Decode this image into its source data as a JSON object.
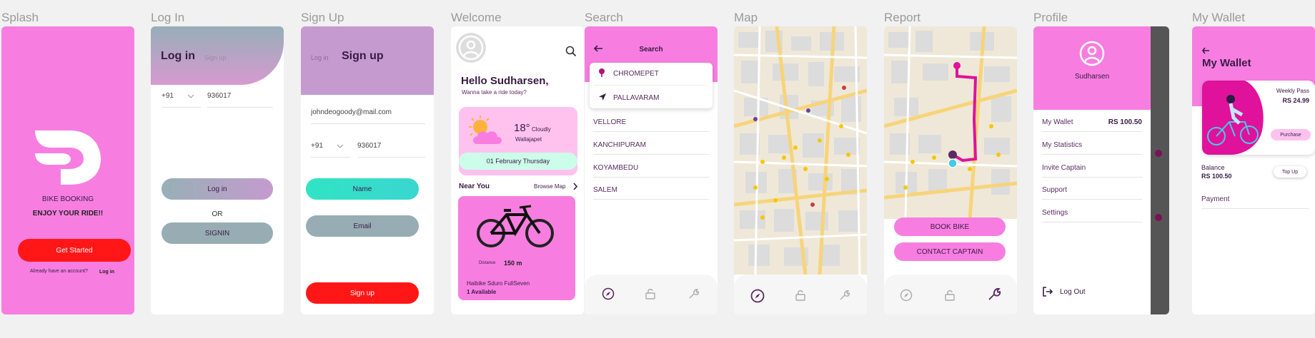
{
  "frames": {
    "splash": "Splash",
    "login": "Log In",
    "signup": "Sign Up",
    "welcome": "Welcome",
    "search": "Search",
    "map": "Map",
    "report": "Report",
    "profile": "Profile",
    "wallet": "My Wallet"
  },
  "splash": {
    "title": "BIKE BOOKING",
    "tagline": "ENJOY YOUR RIDE!!",
    "cta": "Get Started",
    "have_account": "Already have an account?",
    "login_link": "Log in"
  },
  "login": {
    "tab_active": "Log in",
    "tab_inactive": "Sign up",
    "country_code": "+91",
    "phone": "936017",
    "login_button": "Log in",
    "or": "OR",
    "signin_button": "SIGNIN"
  },
  "signup": {
    "tab_inactive": "Log in",
    "tab_active": "Sign up",
    "email": "johndeogoody@mail.com",
    "country_code": "+91",
    "phone": "936017",
    "name_button": "Name",
    "email_button": "Email",
    "signup_button": "Sign up"
  },
  "welcome": {
    "greeting": "Hello Sudharsen,",
    "sub": "Wanna take a ride today?",
    "temperature": "18°",
    "condition": "Cloudly",
    "location": "Wallajapet",
    "date": "01 February Thursday",
    "near_you": "Near You",
    "browse_map": "Browse Map",
    "distance_label": "Distance",
    "distance": "150 m",
    "bike_name": "Haibike Sduro FullSeven",
    "availability": "1 Available"
  },
  "search": {
    "title": "Search",
    "suggestions": [
      "CHROMEPET",
      "PALLAVARAM"
    ],
    "places": [
      "VELLORE",
      "KANCHIPURAM",
      "KOYAMBEDU",
      "SALEM"
    ]
  },
  "report": {
    "book_button": "BOOK BIKE",
    "contact_button": "CONTACT CAPTAIN"
  },
  "profile": {
    "name": "Sudharsen",
    "wallet_label": "My Wallet",
    "wallet_amount": "RS 100.50",
    "menu": [
      "My Statistics",
      "Invite Captain",
      "Support",
      "Settings"
    ],
    "logout": "Log Out"
  },
  "wallet": {
    "title": "My Wallet",
    "pass_name": "Weekly Pass",
    "pass_price": "RS 24.99",
    "purchase": "Purchase",
    "balance_label": "Balance",
    "balance": "RS 100.50",
    "topup": "Top Up",
    "payment": "Payment"
  },
  "colors": {
    "pink": "#f77ee0",
    "red": "#ff1717",
    "teal": "#30e4c4",
    "mauve": "#c59bcf",
    "grey_blue": "#97adb3"
  }
}
